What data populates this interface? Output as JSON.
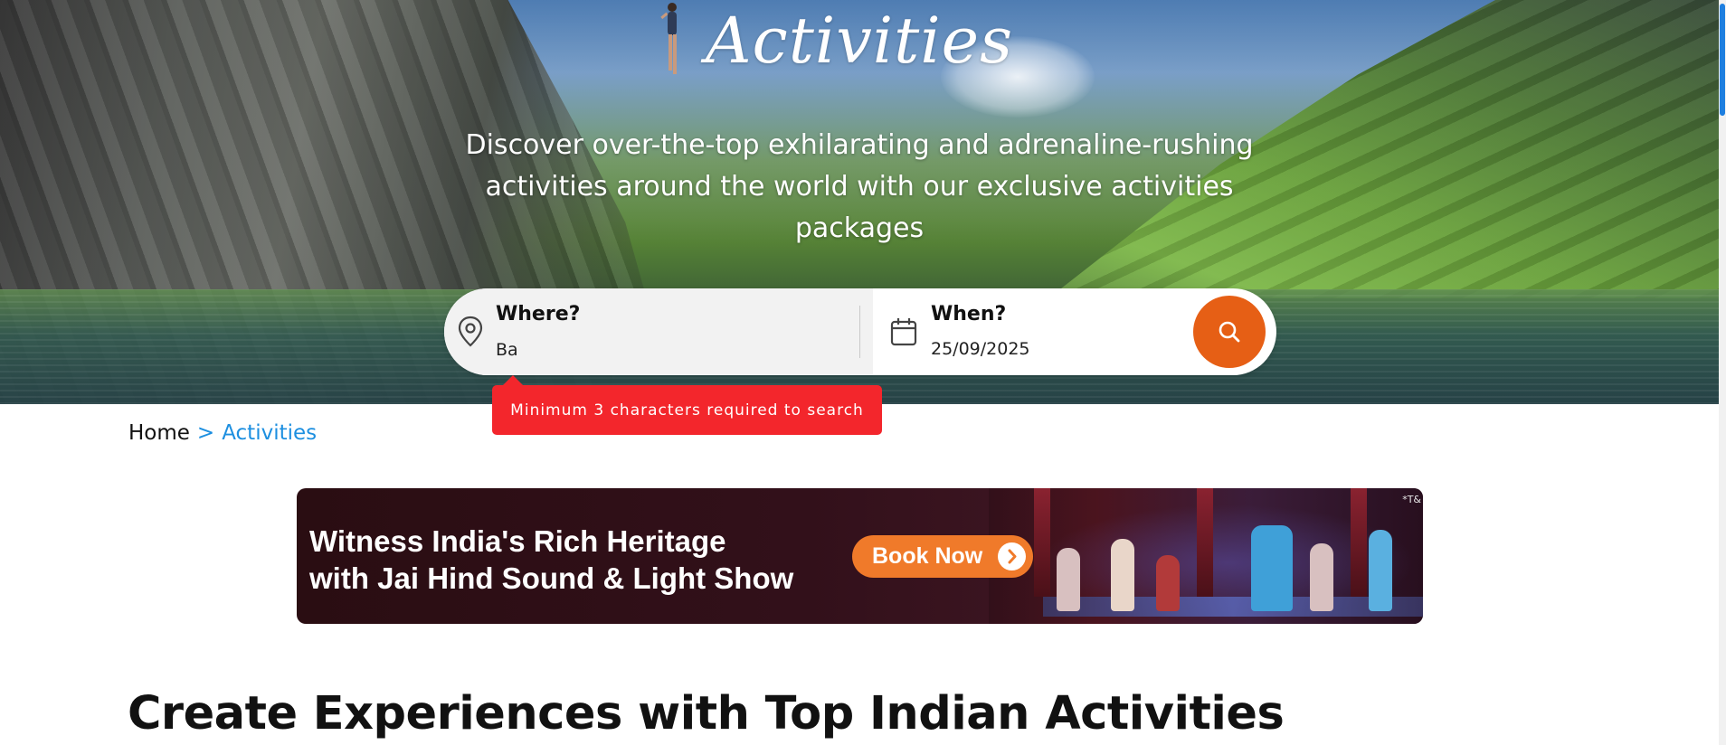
{
  "hero": {
    "title": "Activities",
    "subtitle_lines": [
      "Discover over-the-top exhilarating and adrenaline-rushing",
      "activities around the world with our exclusive activities",
      "packages"
    ]
  },
  "search": {
    "where_label": "Where?",
    "where_value": "Ba",
    "when_label": "When?",
    "when_value": "25/09/2025",
    "where_icon": "map-pin-icon",
    "when_icon": "calendar-icon",
    "search_icon": "search-icon",
    "accent_color": "#e65f15"
  },
  "validation": {
    "message": "Minimum 3 characters required to search",
    "color": "#f3262c"
  },
  "breadcrumb": {
    "home": "Home",
    "separator": ">",
    "current": "Activities",
    "link_color": "#1d8fe0"
  },
  "banner": {
    "line1": "Witness India's Rich Heritage",
    "line2": "with Jai Hind Sound & Light Show",
    "cta": "Book Now",
    "cta_icon": "chevron-right-icon",
    "terms": "*T&"
  },
  "section": {
    "heading": "Create Experiences with Top Indian Activities"
  }
}
